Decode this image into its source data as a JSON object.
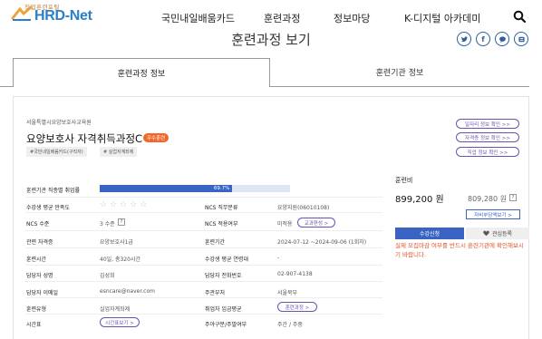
{
  "header": {
    "logo_small": "직업훈련포털",
    "logo_main": "HRD-Net",
    "nav": [
      "국민내일배움카드",
      "훈련과정",
      "정보마당",
      "K-디지털 아카데미"
    ],
    "search_icon": "search-icon"
  },
  "page_title": "훈련과정 보기",
  "sns": [
    "twitter-icon",
    "facebook-icon",
    "talk-icon",
    "kakaostory-icon"
  ],
  "tabs": {
    "active": "훈련과정 정보",
    "inactive": "훈련기관 정보"
  },
  "course": {
    "institution": "서울특별시요양보호사교육원",
    "title": "요양보호사 자격취득과정C",
    "badge": "우수훈련",
    "tags": [
      "#국민내일배움카드(구직자)",
      "# 실업자계좌제"
    ],
    "links": [
      "일자리 정보 확인 >>",
      "자격증 정보 확인 >>",
      "직업 정보 확인 >>"
    ]
  },
  "info": {
    "employment_label": "훈련기관 직종별 취업률",
    "employment_rate": "69.7%",
    "employment_fraction": 0.697,
    "satisfaction_label": "수강생 평균 만족도",
    "stars_total": 5,
    "stars_filled": 0,
    "ncs_level_label": "NCS 수준",
    "ncs_level_value": "3 수준",
    "ncs_job_label": "NCS 직무분류",
    "ncs_job_value": "요양지원(06010108)",
    "ncs_apply_label": "NCS 적용여부",
    "ncs_apply_value": "미적용",
    "curriculum_btn": "교과편성 >",
    "cert_label": "관련 자격증",
    "cert_value": "요양보호사1급",
    "period_label": "훈련기간",
    "period_value": "2024-07-12 ~2024-09-06 (1회차)",
    "hours_label": "훈련시간",
    "hours_value": "40일, 총320시간",
    "age_label": "수강생 평균 연령대",
    "age_value": "-",
    "manager_label": "담당자 성명",
    "manager_value": "김성희",
    "phone_label": "담당자 전화번호",
    "phone_value": "02-907-4138",
    "email_label": "담당자 이메일",
    "email_value": "esncare@naver.com",
    "ministry_label": "주관부처",
    "ministry_value": "서울북부",
    "type_label": "훈련유형",
    "type_value": "실업자계좌제",
    "wage_label": "취업자 임금평균",
    "wage_btn": "훈련과정 >",
    "timetable_label": "시간표",
    "timetable_btn": "시간표보기 >",
    "weekday_label": "주야구분/주말여부",
    "weekday_value": "주간 / 주중"
  },
  "fee": {
    "label": "훈련비",
    "main": "899,200 원",
    "sub": "809,280 원",
    "sub_help": "?",
    "self_pay_btn": "자비부담액보기 >",
    "apply_btn": "수강신청",
    "interest_btn": "관심등록",
    "warning": "실제 모집마감 여부를 반드시 훈련기관에 확인해보시기 바랍니다."
  },
  "colors": {
    "primary": "#3a64c4",
    "accent_orange": "#f2682a",
    "pill_purple": "#6b52b0",
    "warning_red": "#e0532a",
    "logo_blue": "#2b7fc8"
  }
}
